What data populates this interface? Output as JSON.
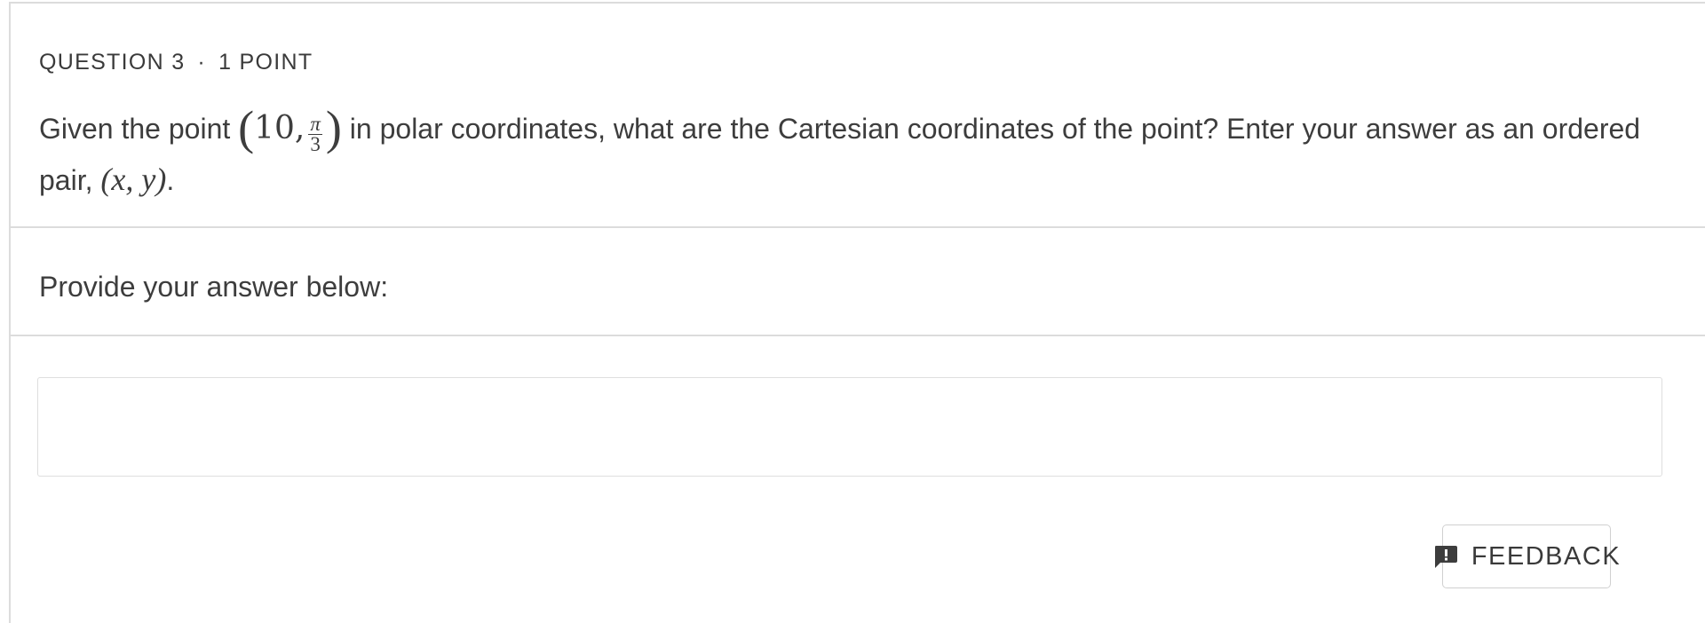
{
  "question": {
    "number_label": "QUESTION 3",
    "separator": "·",
    "points_label": "1 POINT",
    "prompt_before": "Given the point",
    "math_r": "10,",
    "math_theta_num": "π",
    "math_theta_den": "3",
    "prompt_after": "in polar coordinates, what are the Cartesian coordinates of the point? Enter your answer as an ordered pair,",
    "ordered_pair": "(x, y)",
    "prompt_end": "."
  },
  "instruction": {
    "text": "Provide your answer below:"
  },
  "answer": {
    "value": "",
    "placeholder": ""
  },
  "feedback": {
    "label": "FEEDBACK",
    "icon": "feedback-exclamation-icon"
  }
}
